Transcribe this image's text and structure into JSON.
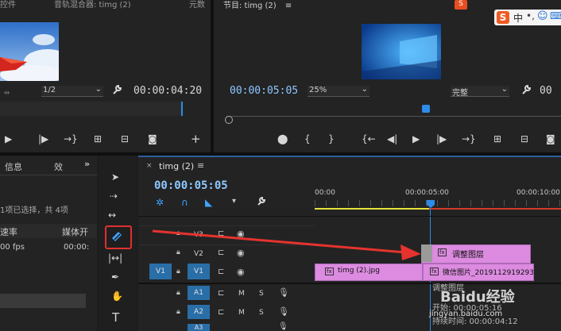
{
  "source_monitor": {
    "tab_left": "控件",
    "tab_title": "音轨混合器: timg (2)",
    "tab_right": "元数",
    "ratio_value": "1/2",
    "timecode": "00:00:04:20"
  },
  "program_monitor": {
    "title": "节目: timg (2)",
    "timecode": "00:00:05:05",
    "zoom_value": "25%",
    "quality_value": "完整"
  },
  "ime": {
    "logo": "S",
    "lang": "中"
  },
  "project_panel": {
    "tab_info": "信息",
    "tab_effects": "效",
    "selection_text": "1项已选择，共 4项",
    "col_rate": "速率",
    "col_media": "媒体开",
    "row_rate": "00 fps",
    "row_media": "00:00:"
  },
  "timeline": {
    "tab_name": "timg (2)",
    "timecode": "00:00:05:05",
    "ruler": [
      "00:00",
      "00:00:05:00",
      "00:00:10:00"
    ],
    "tracks_video": [
      "V3",
      "V2",
      "V1"
    ],
    "tracks_audio": [
      "A1",
      "A2",
      "A3"
    ],
    "source_patch_v": "V1",
    "mute_label": "M",
    "solo_label": "S",
    "clips": {
      "adjustment_layer": "调整图层",
      "timg_clip": "timg (2).jpg",
      "wechat_clip": "微信图片_20191129192931.p",
      "fx": "fx"
    },
    "tooltip_name": "调整图层",
    "tooltip_start": "开始: 00:00:05:16",
    "tooltip_duration": "持续时间: 00:00:04:12"
  },
  "watermark": "Baidu经验",
  "watermark_url": "jingyan.baidu.com",
  "colors": {
    "accent_blue": "#2d8ceb",
    "clip_pink": "#dc8be0",
    "arrow_red": "#e5332f",
    "highlight_box": "#e03030"
  }
}
